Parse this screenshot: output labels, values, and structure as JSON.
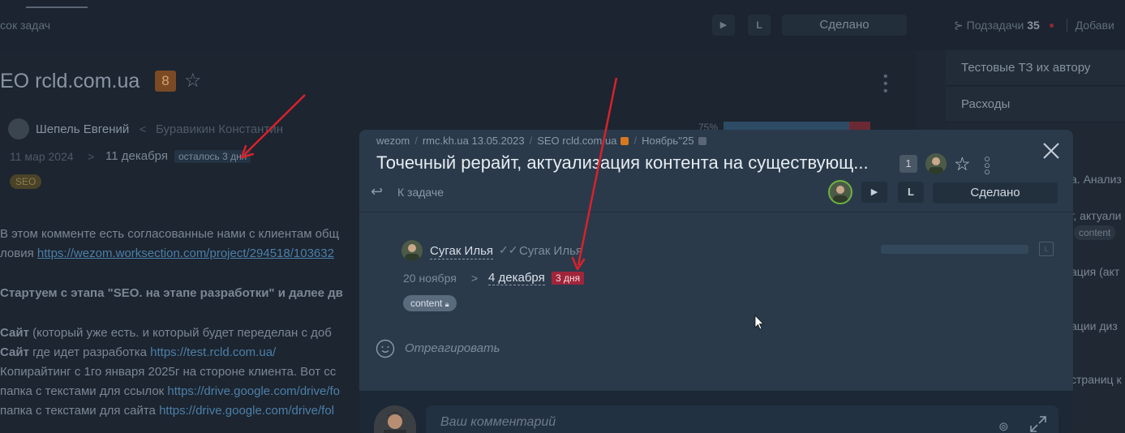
{
  "topbar": {
    "crumb": "сок задач",
    "done_label": "Сделано",
    "play_icon": "▶",
    "timer_icon": "L",
    "subtasks_label": "Подзадачи",
    "subtasks_count": "35",
    "add_label": "Добави"
  },
  "bg_task": {
    "title": "EO rcld.com.ua",
    "count": "8",
    "author": "Шепель Евгений",
    "separator": "<",
    "assignee": "Буравикин Константин",
    "date_start": "11 мар 2024",
    "arrow": ">",
    "date_end": "11 декабря",
    "time_left": "осталось 3 дня",
    "tag": "SEO",
    "progress_pct": "75%",
    "lines": [
      {
        "prefix": "В этом комменте есть согласованные нами с клиентам общ",
        "link": ""
      },
      {
        "prefix": "ловия ",
        "link": "https://wezom.worksection.com/project/294518/103632"
      },
      {
        "prefix": "Стартуем с этапа \"SEO. на этапе разработки\" и далее дв",
        "link": ""
      },
      {
        "prefix": "Сайт",
        "rest": " (который уже есть. и который будет переделан с доб",
        "link": ""
      },
      {
        "prefix": "Сайт",
        "rest": " где идет разработка ",
        "link": "https://test.rcld.com.ua/"
      },
      {
        "prefix": "Копирайтинг с 1го января 2025г на стороне клиента. Вот сс",
        "link": ""
      },
      {
        "prefix": "папка с текстами для ссылок ",
        "link": "https://drive.google.com/drive/fo"
      },
      {
        "prefix": "папка с текстами для сайта ",
        "link": "https://drive.google.com/drive/fol"
      }
    ]
  },
  "right_panel": {
    "menu": [
      "Тестовые ТЗ их автору",
      "Расходы"
    ],
    "snippets": [
      "а. Анализ",
      "г, актуали",
      "ация (акт",
      "ации диз",
      "страниц к"
    ],
    "tag": "content"
  },
  "modal": {
    "breadcrumbs": [
      "wezom",
      "rmc.kh.ua 13.05.2023",
      "SEO rcld.com.ua",
      "Ноябрь''25"
    ],
    "crumb_colors": {
      "seo": "#d9781f",
      "month": "#5a6675"
    },
    "title": "Точечный рерайт, актуализация контента на существующ...",
    "subtask_count": "1",
    "back_label": "К задаче",
    "play_icon": "▶",
    "timer_icon": "L",
    "done_label": "Сделано",
    "author": "Сугак Илья",
    "check_icon": "✓✓",
    "assignee": "Сугак Илья",
    "date_start": "20 ноября",
    "arrow": ">",
    "date_end": "4 декабря",
    "time_left": "3 дня",
    "tag": "content",
    "react_label": "Отреагировать",
    "comment_placeholder": "Ваш комментарий"
  },
  "colors": {
    "accent_red": "#a0253a",
    "annotation_arrow": "#d9212b",
    "status_green": "#6cb33e"
  }
}
